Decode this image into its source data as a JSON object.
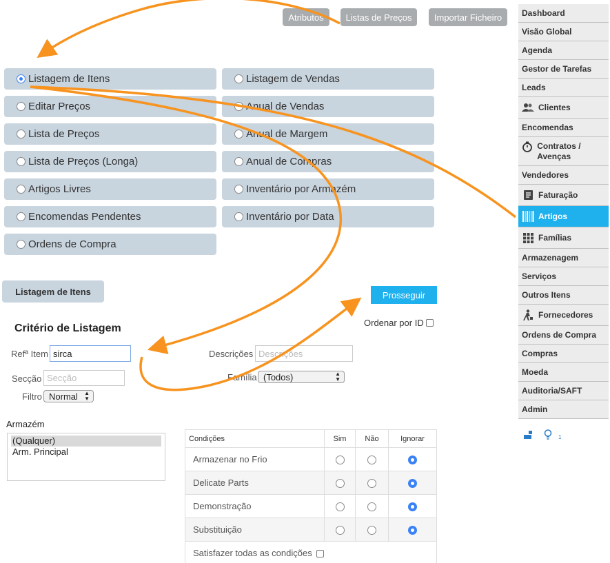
{
  "top_buttons": {
    "atributos": "Atributos",
    "listas": "Listas de Preços",
    "importar": "Importar Ficheiro"
  },
  "report_options": {
    "listagem_itens": "Listagem de Itens",
    "editar_precos": "Editar Preços",
    "lista_precos": "Lista de Preços",
    "lista_precos_longa": "Lista de Preços (Longa)",
    "artigos_livres": "Artigos Livres",
    "encomendas_pendentes": "Encomendas Pendentes",
    "ordens_compra": "Ordens de Compra",
    "listagem_vendas": "Listagem de Vendas",
    "anual_vendas": "Anual de Vendas",
    "anual_margem": "Anual de Margem",
    "anual_compras": "Anual de Compras",
    "inventario_armazem": "Inventário por Armazém",
    "inventario_data": "Inventário por Data",
    "selected": "Listagem de Itens"
  },
  "tab_label": "Listagem de Itens",
  "proceed_label": "Prosseguir",
  "sort_by_id_label": "Ordenar por ID",
  "criteria_title": "Critério de Listagem",
  "form": {
    "ref_label": "Refª Item",
    "ref_value": "sirca",
    "desc_label": "Descrições",
    "desc_placeholder": "Descrições",
    "seccao_label": "Secção",
    "seccao_placeholder": "Secção",
    "familia_label": "Família",
    "familia_value": "(Todos)",
    "filtro_label": "Filtro",
    "filtro_value": "Normal"
  },
  "armazem": {
    "label": "Armazém",
    "options": [
      "(Qualquer)",
      "Arm. Principal"
    ],
    "selected": "(Qualquer)"
  },
  "conditions": {
    "headers": [
      "Condições",
      "Sim",
      "Não",
      "Ignorar"
    ],
    "rows": [
      {
        "label": "Armazenar no Frio",
        "value": "Ignorar"
      },
      {
        "label": "Delicate Parts",
        "value": "Ignorar"
      },
      {
        "label": "Demonstração",
        "value": "Ignorar"
      },
      {
        "label": "Substituição",
        "value": "Ignorar"
      }
    ],
    "satisfy_all_label": "Satisfazer todas as condições"
  },
  "sidebar": {
    "items": [
      "Dashboard",
      "Visão Global",
      "Agenda",
      "Gestor de Tarefas",
      "Leads",
      "Clientes",
      "Encomendas",
      "Contratos / Avenças",
      "Vendedores",
      "Faturação",
      "Artigos",
      "Famílias",
      "Armazenagem",
      "Serviços",
      "Outros Itens",
      "Fornecedores",
      "Ordens de Compra",
      "Compras",
      "Moeda",
      "Auditoria/SAFT",
      "Admin"
    ],
    "active": "Artigos",
    "bottom_count": "1"
  },
  "colors": {
    "accent": "#1fb0ee",
    "option_bg": "#c8d4de",
    "arrow": "#f7931e"
  }
}
